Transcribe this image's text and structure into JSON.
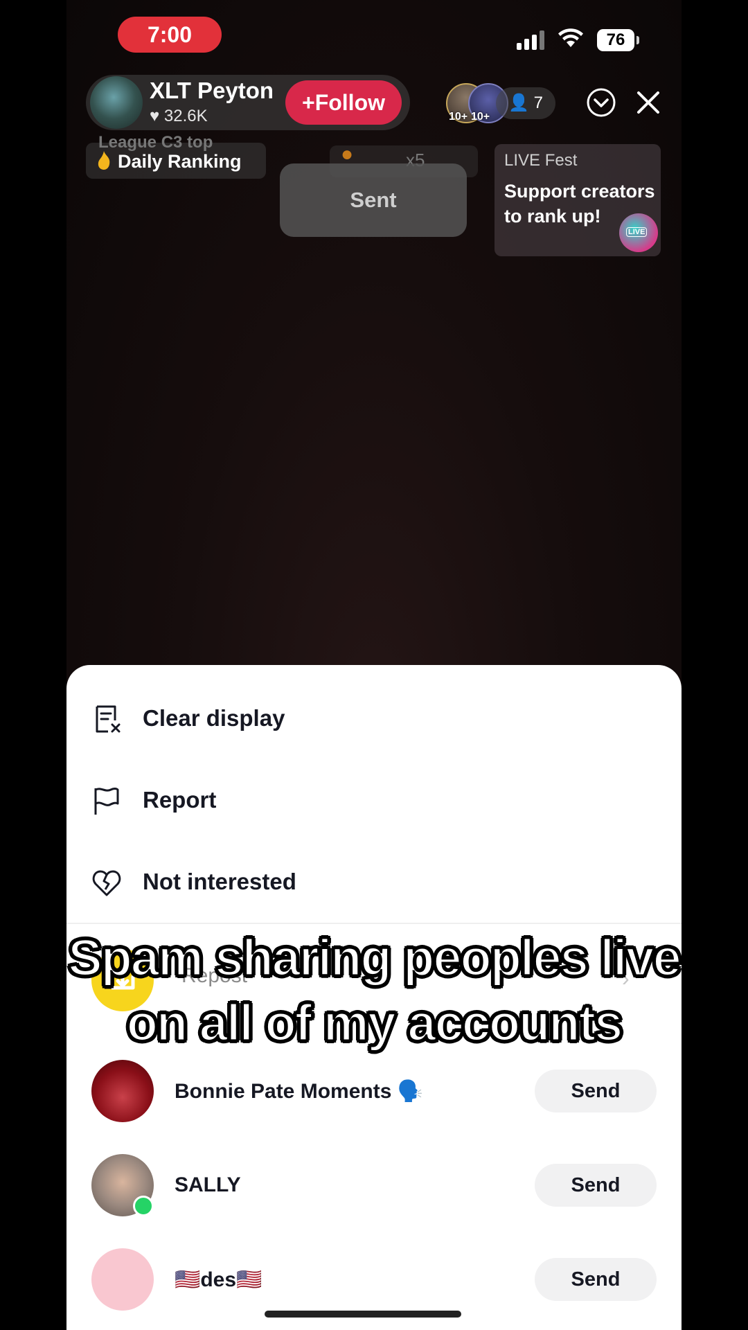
{
  "status_bar": {
    "time": "7:00",
    "battery": "76"
  },
  "host": {
    "name": "XLT Peyton",
    "likes": "32.6K",
    "follow_label": "Follow"
  },
  "viewers": {
    "badge_1": "10+",
    "badge_2": "10+",
    "count": "7"
  },
  "ranking": {
    "ghost_text": "League C3 top",
    "label": "Daily Ranking"
  },
  "gift": {
    "multiplier": "x5"
  },
  "toast": {
    "text": "Sent"
  },
  "live_fest": {
    "title": "LIVE Fest",
    "text": "Support creators to rank up!",
    "badge": "LIVE"
  },
  "menu": {
    "clear_display": "Clear display",
    "report": "Report",
    "not_interested": "Not interested"
  },
  "repost": {
    "label": "Repost"
  },
  "caption": {
    "line1": "Spam sharing peoples live",
    "line2": "on all of my accounts"
  },
  "share_list": [
    {
      "name": "Bonnie Pate Moments 🗣️",
      "send_label": "Send",
      "avatar_color": "#a3131c"
    },
    {
      "name": "SALLY",
      "send_label": "Send",
      "avatar_color": "#9a8d85"
    },
    {
      "name": "🇺🇸des🇺🇸",
      "send_label": "Send",
      "avatar_color": "#f9c7d0"
    }
  ],
  "colors": {
    "follow": "#d8284a",
    "time_pill": "#e2313a",
    "repost": "#f7d51d",
    "online": "#25d366"
  }
}
